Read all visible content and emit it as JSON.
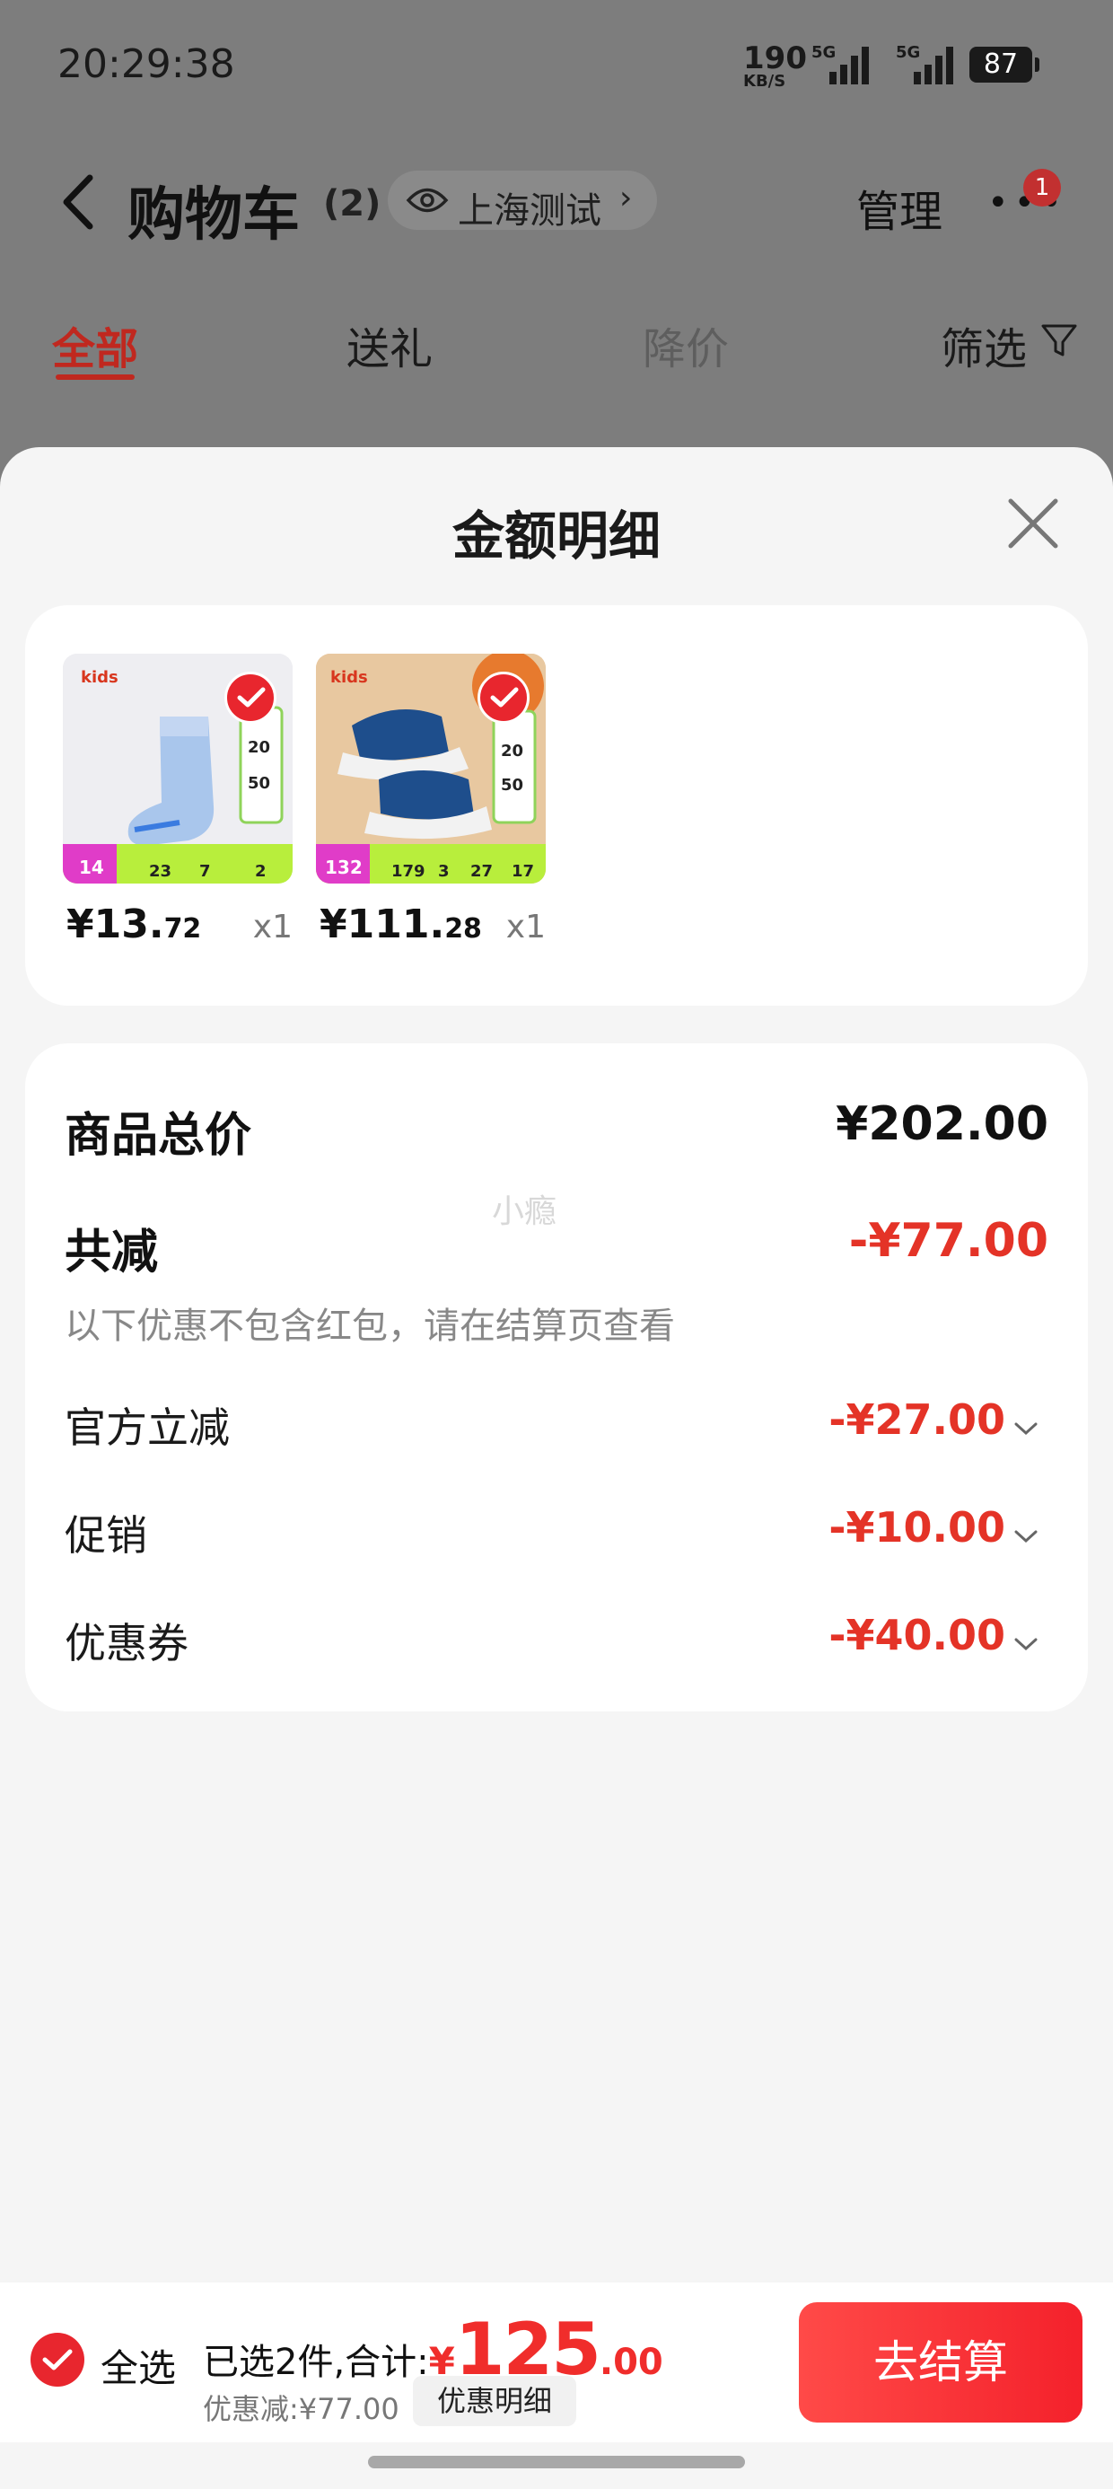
{
  "status_bar": {
    "time": "20:29:38",
    "speed_value": "190",
    "speed_unit": "KB/S",
    "signal_1": "5G",
    "signal_2": "5G",
    "battery": "87"
  },
  "cart_header": {
    "title": "购物车",
    "count": "(2)",
    "location": "上海测试",
    "manage_label": "管理",
    "notification_count": "1"
  },
  "tabs": [
    {
      "label": "全部",
      "active": true
    },
    {
      "label": "送礼",
      "active": false
    },
    {
      "label": "降价",
      "active": false
    },
    {
      "label": "筛选",
      "active": false
    }
  ],
  "sheet": {
    "title": "金额明细",
    "products": [
      {
        "price_int": "¥13.",
        "price_dec": "72",
        "qty": "x1",
        "selected": true,
        "image_icon": "sock-icon"
      },
      {
        "price_int": "¥111.",
        "price_dec": "28",
        "qty": "x1",
        "selected": true,
        "image_icon": "sandal-icon"
      }
    ],
    "breakdown": {
      "subtotal_label": "商品总价",
      "subtotal_value": "¥202.00",
      "total_discount_label": "共减",
      "total_discount_value": "-¥77.00",
      "note": "以下优惠不包含红包，请在结算页查看",
      "watermark": "小瘾",
      "items": [
        {
          "label": "官方立减",
          "value": "-¥27.00"
        },
        {
          "label": "促销",
          "value": "-¥10.00"
        },
        {
          "label": "优惠券",
          "value": "-¥40.00"
        }
      ]
    }
  },
  "checkout_bar": {
    "select_all_label": "全选",
    "selected_summary": "已选2件,合计:",
    "total_yen": "¥",
    "total_int": "125",
    "total_dec": ".00",
    "discount_text": "优惠减:¥77.00",
    "discount_detail_label": "优惠明细",
    "checkout_label": "去结算"
  },
  "colors": {
    "accent_red": "#e8262e",
    "price_red": "#e43327",
    "checkout_gradient_start": "#ff4a48",
    "checkout_gradient_end": "#f4212b"
  }
}
